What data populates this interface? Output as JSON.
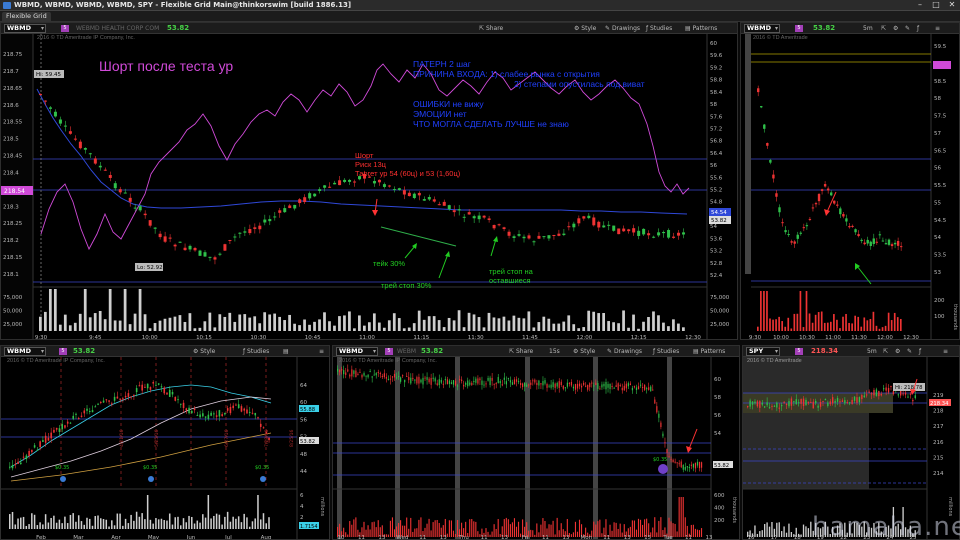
{
  "window": {
    "title": "WBMD, WBMD, WBMD, WBMD, SPY - Flexible Grid Main@thinkorswim [build 1886.13]",
    "tab": "Flexible Grid"
  },
  "main": {
    "symbol": "WBMD",
    "badge": "5",
    "company": "WEBMD HEALTH CORP COM",
    "price": "53.82",
    "buttons": {
      "share": "Share",
      "style": "Style",
      "drawings": "Drawings",
      "studies": "Studies",
      "patterns": "Patterns"
    },
    "copyright": "2016 © TD Ameritrade IP Company, Inc.",
    "hi_label": "Hi: 59.45",
    "lo_label": "Lo: 52.92",
    "left_price_tag": "218.54",
    "right_tag_1": "54.54",
    "right_tag_2": "53.82",
    "left_ticks": [
      "218.75",
      "218.7",
      "218.65",
      "218.6",
      "218.55",
      "218.5",
      "218.45",
      "218.4",
      "218.35",
      "218.3",
      "218.25",
      "218.2",
      "218.15",
      "218.1"
    ],
    "right_ticks": [
      "60",
      "59.6",
      "59.2",
      "58.8",
      "58.4",
      "58",
      "57.6",
      "57.2",
      "56.8",
      "56.4",
      "56",
      "55.6",
      "55.2",
      "54.8",
      "54.4",
      "54",
      "53.6",
      "53.2",
      "52.8",
      "52.4"
    ],
    "vol_ticks": [
      "75,000",
      "50,000",
      "25,000"
    ],
    "time_ticks": [
      "9:30",
      "9:45",
      "10:00",
      "10:15",
      "10:30",
      "10:45",
      "11:00",
      "11:15",
      "11:30",
      "11:45",
      "12:00",
      "12:15",
      "12:30"
    ],
    "heading": "Шорт после  теста ур",
    "notes": {
      "line1": "ПАТЕРН 2 шаг",
      "line2": "ПРИЧИНА ВХОДА:  1) слабее рынка с открытия",
      "line3": "2) степами опустилась под виват",
      "line4": "ОШИБКИ не вижу",
      "line5": "ЭМОЦИИ нет",
      "line6": "ЧТО МОГЛА СДЕЛАТЬ ЛУЧШЕ не знаю"
    },
    "short_note": {
      "l1": "Шорт",
      "l2": "Риск 13ц",
      "l3": "Таргет ур 54 (60ц) и 53 (1,60ц)"
    },
    "take_note": "тейк 30%",
    "trail1": "трей стоп 30%",
    "trail2a": "трей стоп на",
    "trail2b": "оставшиеся"
  },
  "top_right": {
    "symbol": "WBMD",
    "badge": "5",
    "price": "53.82",
    "agg": "5m",
    "copyright": "2016 © TD Ameritrade",
    "ticks": [
      "59.5",
      "59",
      "58.5",
      "58",
      "57.5",
      "57",
      "56.5",
      "56",
      "55.5",
      "55",
      "54.5",
      "54",
      "53.5",
      "53"
    ],
    "vol_ticks": [
      "200",
      "100"
    ],
    "vol_axis_label": "thousands",
    "time_ticks": [
      "9:30",
      "10:00",
      "10:30",
      "11:00",
      "11:30",
      "12:00",
      "12:30"
    ]
  },
  "bottom_left": {
    "symbol": "WBMD",
    "badge": "5",
    "price": "53.82",
    "buttons": {
      "style": "Style",
      "studies": "Studies"
    },
    "copyright": "2016 © TD Ameritrade IP Company, Inc.",
    "ticks": [
      "64",
      "60",
      "56",
      "52",
      "48",
      "44"
    ],
    "tag_1": "55.88",
    "tag_2": "53.82",
    "div_labels": [
      "$0.35",
      "$0.35",
      "$0.35"
    ],
    "date_marks": [
      "4/21/16",
      "5/25/16",
      "6/27/16",
      "7/28/16",
      "8/25/16"
    ],
    "vol_ticks": [
      "6",
      "4",
      "2"
    ],
    "vol_tag": "1.7154",
    "vol_axis_label": "millions",
    "months": [
      "Feb",
      "Mar",
      "Apr",
      "May",
      "Jun",
      "Jul",
      "Aug"
    ]
  },
  "bottom_mid": {
    "symbol": "WBMD",
    "badge": "5",
    "company": "WEBM",
    "price": "53.82",
    "agg": "15s",
    "buttons": {
      "share": "Share",
      "style": "Style",
      "drawings": "Drawings",
      "studies": "Studies",
      "patterns": "Patterns"
    },
    "copyright": "2016 © TD Ameritrade IP Company, Inc.",
    "ticks": [
      "60",
      "58",
      "56",
      "54"
    ],
    "tag": "53.82",
    "event_label": "$0.35",
    "vol_ticks": [
      "600",
      "400",
      "200"
    ],
    "vol_axis_label": "thousands",
    "days": [
      "10",
      "11",
      "13",
      "Wed",
      "11",
      "13",
      "Thu",
      "11",
      "13",
      "Fri",
      "11",
      "13",
      "Mon",
      "11",
      "13",
      "15",
      "Tue",
      "11",
      "13"
    ]
  },
  "bottom_right": {
    "symbol": "SPY",
    "badge": "5",
    "price": "218.34",
    "agg": "5m",
    "copyright": "2016 © TD Ameritrade",
    "hi_label": "Hi: 218.78",
    "tag": "218.34",
    "ticks": [
      "219",
      "218",
      "217",
      "216",
      "215",
      "214"
    ],
    "vol_axis_label": "millions",
    "days": [
      "16",
      "17",
      "18",
      "19",
      "22",
      "23",
      "24",
      "25"
    ]
  },
  "watermark": "hamaha.net"
}
